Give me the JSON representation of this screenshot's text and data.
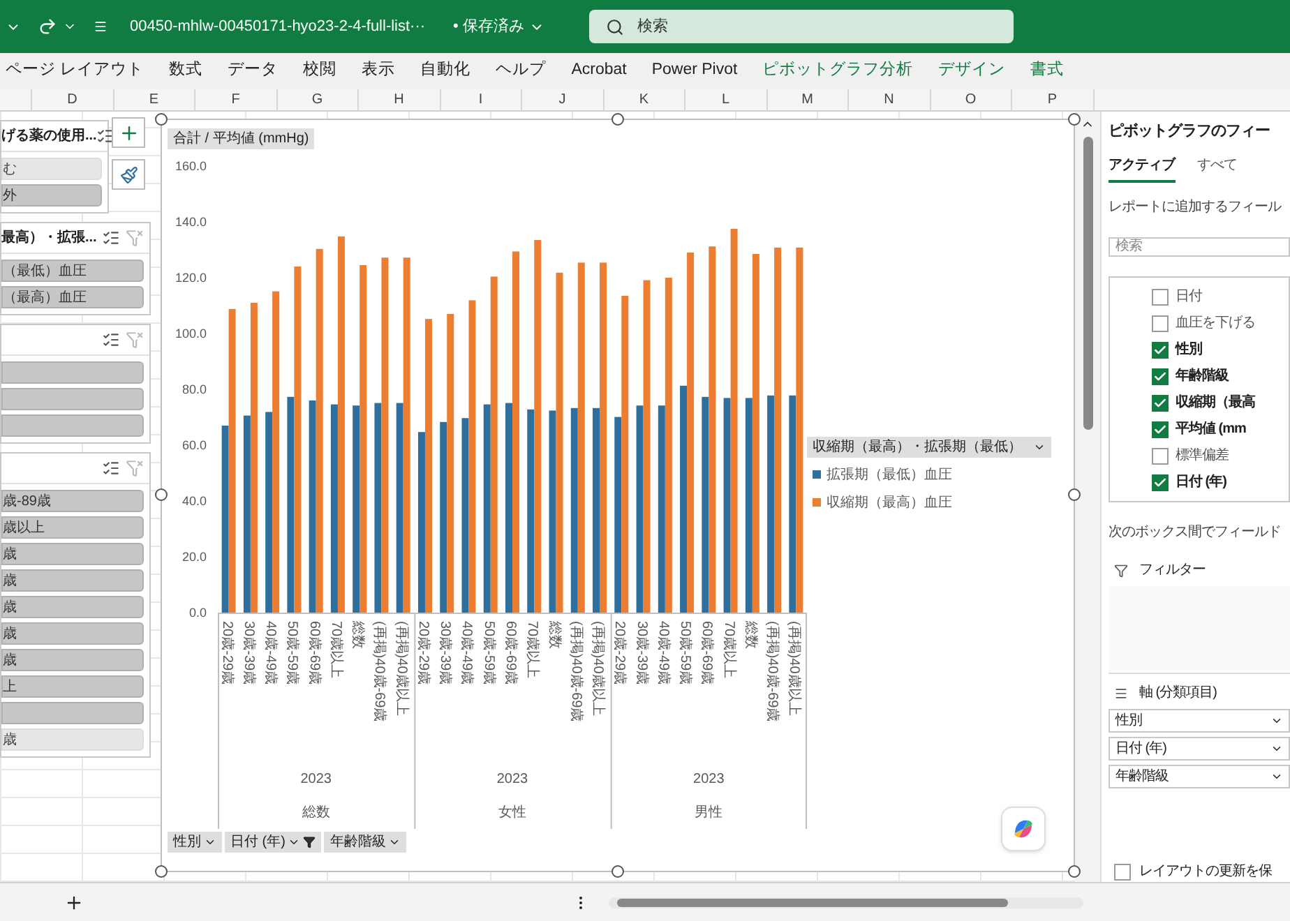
{
  "title_bar": {
    "file_name": "00450-mhlw-00450171-hyo23-2-4-full-list···",
    "save_status": "• 保存済み",
    "search": {
      "placeholder": "検索"
    }
  },
  "ribbon_tabs": [
    {
      "label": "ページ レイアウト",
      "kind": "standard"
    },
    {
      "label": "数式",
      "kind": "standard"
    },
    {
      "label": "データ",
      "kind": "standard"
    },
    {
      "label": "校閲",
      "kind": "standard"
    },
    {
      "label": "表示",
      "kind": "standard"
    },
    {
      "label": "自動化",
      "kind": "standard"
    },
    {
      "label": "ヘルプ",
      "kind": "standard"
    },
    {
      "label": "Acrobat",
      "kind": "standard"
    },
    {
      "label": "Power Pivot",
      "kind": "standard"
    },
    {
      "label": "ピボットグラフ分析",
      "kind": "contextual"
    },
    {
      "label": "デザイン",
      "kind": "contextual"
    },
    {
      "label": "書式",
      "kind": "contextual"
    }
  ],
  "column_headers": [
    "D",
    "E",
    "F",
    "G",
    "H",
    "I",
    "J",
    "K",
    "L",
    "M",
    "N",
    "O",
    "P"
  ],
  "slicers": [
    {
      "header": "げる薬の使用...",
      "items": [
        {
          "label": "む",
          "selected": false
        },
        {
          "label": "外",
          "selected": true
        }
      ]
    },
    {
      "header": "最高）・拡張...",
      "items": [
        {
          "label": "（最低）血圧",
          "selected": true
        },
        {
          "label": "（最高）血圧",
          "selected": true
        }
      ]
    },
    {
      "items": [
        {
          "selected": true
        },
        {
          "selected": true
        },
        {
          "selected": true
        }
      ]
    },
    {
      "items": [
        {
          "label": "歳-89歳",
          "selected": true
        },
        {
          "label": "歳以上",
          "selected": true
        },
        {
          "label": "歳",
          "selected": true
        },
        {
          "label": "歳",
          "selected": true
        },
        {
          "label": "歳",
          "selected": true
        },
        {
          "label": "歳",
          "selected": true
        },
        {
          "label": "歳",
          "selected": true
        },
        {
          "label": "上",
          "selected": true
        },
        {
          "selected": true
        },
        {
          "label": "歳",
          "selected": false
        }
      ]
    }
  ],
  "chart": {
    "field_button": "合計 / 平均値 (mmHg)",
    "chart_data": {
      "type": "bar",
      "categories": [
        "20歳-29歳",
        "30歳-39歳",
        "40歳-49歳",
        "50歳-59歳",
        "60歳-69歳",
        "70歳以上",
        "総数",
        "(再掲)40歳-69歳",
        "(再掲)40歳以上",
        "20歳-29歳",
        "30歳-39歳",
        "40歳-49歳",
        "50歳-59歳",
        "60歳-69歳",
        "70歳以上",
        "総数",
        "(再掲)40歳-69歳",
        "(再掲)40歳以上",
        "20歳-29歳",
        "30歳-39歳",
        "40歳-49歳",
        "50歳-59歳",
        "60歳-69歳",
        "70歳以上",
        "総数",
        "(再掲)40歳-69歳",
        "(再掲)40歳以上"
      ],
      "series": [
        {
          "name": "拡張期（最低）血圧",
          "color": "#2e6f9e",
          "values": [
            67.0,
            70.6,
            71.9,
            77.3,
            76.0,
            74.6,
            74.2,
            75.1,
            75.1,
            64.7,
            68.3,
            69.7,
            74.6,
            75.1,
            72.8,
            72.4,
            73.3,
            73.3,
            70.1,
            74.2,
            74.2,
            81.3,
            77.3,
            76.9,
            76.9,
            77.8,
            77.8
          ]
        },
        {
          "name": "収縮期（最高）血圧",
          "color": "#ed7d31",
          "values": [
            108.8,
            111.0,
            115.1,
            124.0,
            130.3,
            134.8,
            124.5,
            127.2,
            127.2,
            105.2,
            107.0,
            111.9,
            120.4,
            129.4,
            133.5,
            121.8,
            125.4,
            125.4,
            113.5,
            119.1,
            120.0,
            129.0,
            131.2,
            137.5,
            128.5,
            130.8,
            130.8
          ]
        }
      ],
      "ylim": [
        0,
        160
      ],
      "yticks": [
        {
          "value": 0,
          "label": "0.0"
        },
        {
          "value": 20,
          "label": "20.0"
        },
        {
          "value": 40,
          "label": "40.0"
        },
        {
          "value": 60,
          "label": "60.0"
        },
        {
          "value": 80,
          "label": "80.0"
        },
        {
          "value": 100,
          "label": "100.0"
        },
        {
          "value": 120,
          "label": "120.0"
        },
        {
          "value": 140,
          "label": "140.0"
        },
        {
          "value": 160,
          "label": "160.0"
        }
      ]
    },
    "category_groups": [
      {
        "year": "2023",
        "label": "総数"
      },
      {
        "year": "2023",
        "label": "女性"
      },
      {
        "year": "2023",
        "label": "男性"
      }
    ],
    "legend": {
      "field_button": "収縮期（最高）・拡張期（最低）"
    },
    "axis_field_buttons": [
      {
        "label": "性別",
        "filtered": false
      },
      {
        "label": "日付 (年)",
        "filtered": true
      },
      {
        "label": "年齢階級",
        "filtered": false
      }
    ]
  },
  "right_pane": {
    "title": "ピボットグラフのフィー",
    "tabs": [
      {
        "label": "アクティブ",
        "selected": true
      },
      {
        "label": "すべて",
        "selected": false
      }
    ],
    "add_fields_label": "レポートに追加するフィール",
    "search": {
      "placeholder": "検索"
    },
    "fields": [
      {
        "label": "日付",
        "checked": false
      },
      {
        "label": "血圧を下げる",
        "checked": false
      },
      {
        "label": "性別",
        "checked": true
      },
      {
        "label": "年齢階級",
        "checked": true
      },
      {
        "label": "収縮期（最高",
        "checked": true
      },
      {
        "label": "平均値 (mm",
        "checked": true
      },
      {
        "label": "標準偏差",
        "checked": false
      },
      {
        "label": "日付 (年)",
        "checked": true
      }
    ],
    "areas_label": "次のボックス間でフィールド",
    "filter_area": {
      "label": "フィルター"
    },
    "axis_area": {
      "label": "軸 (分類項目)",
      "items": [
        "性別",
        "日付 (年)",
        "年齢階級"
      ]
    },
    "defer_update": {
      "label": "レイアウトの更新を保",
      "checked": false
    }
  }
}
